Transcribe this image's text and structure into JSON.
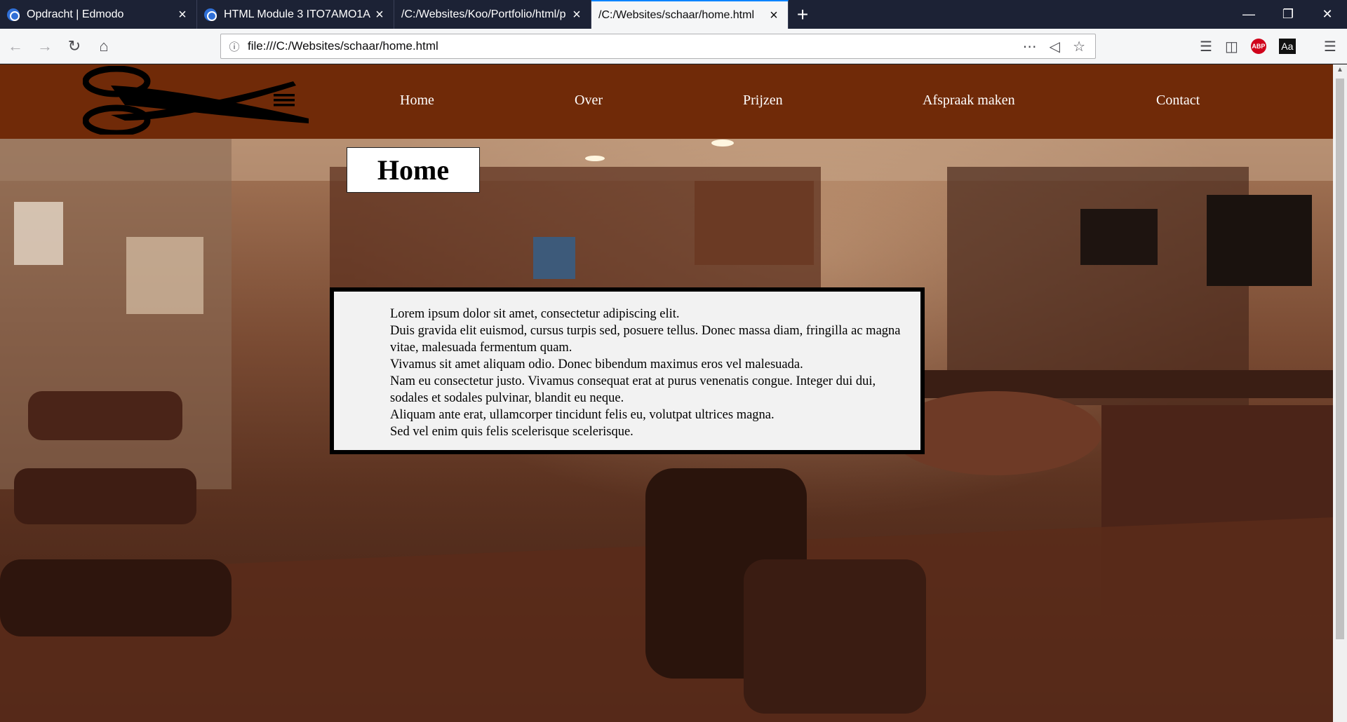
{
  "browser": {
    "tabs": [
      {
        "title": "Opdracht | Edmodo",
        "has_icon": true,
        "active": false
      },
      {
        "title": "HTML Module 3 ITO7AMO1A |",
        "has_icon": true,
        "active": false
      },
      {
        "title": "/C:/Websites/Koo/Portfolio/html/p",
        "has_icon": false,
        "active": false
      },
      {
        "title": "/C:/Websites/schaar/home.html",
        "has_icon": false,
        "active": true
      }
    ],
    "new_tab_symbol": "+",
    "url": "file:///C:/Websites/schaar/home.html",
    "abp_label": "ABP",
    "reader_label": "Aa"
  },
  "site": {
    "nav": [
      {
        "label": "Home"
      },
      {
        "label": "Over"
      },
      {
        "label": "Prijzen"
      },
      {
        "label": "Afspraak maken"
      },
      {
        "label": "Contact"
      }
    ],
    "page_title": "Home",
    "paragraphs": [
      "Lorem ipsum dolor sit amet, consectetur adipiscing elit.",
      "Duis gravida elit euismod, cursus turpis sed, posuere tellus. Donec massa diam, fringilla ac magna vitae, malesuada fermentum quam.",
      "Vivamus sit amet aliquam odio. Donec bibendum maximus eros vel malesuada.",
      "Nam eu consectetur justo. Vivamus consequat erat at purus venenatis congue. Integer dui dui, sodales et sodales pulvinar, blandit eu neque.",
      "Aliquam ante erat, ullamcorper tincidunt felis eu, volutpat ultrices magna.",
      "Sed vel enim quis felis scelerisque scelerisque."
    ],
    "header_color": "#702a08"
  }
}
